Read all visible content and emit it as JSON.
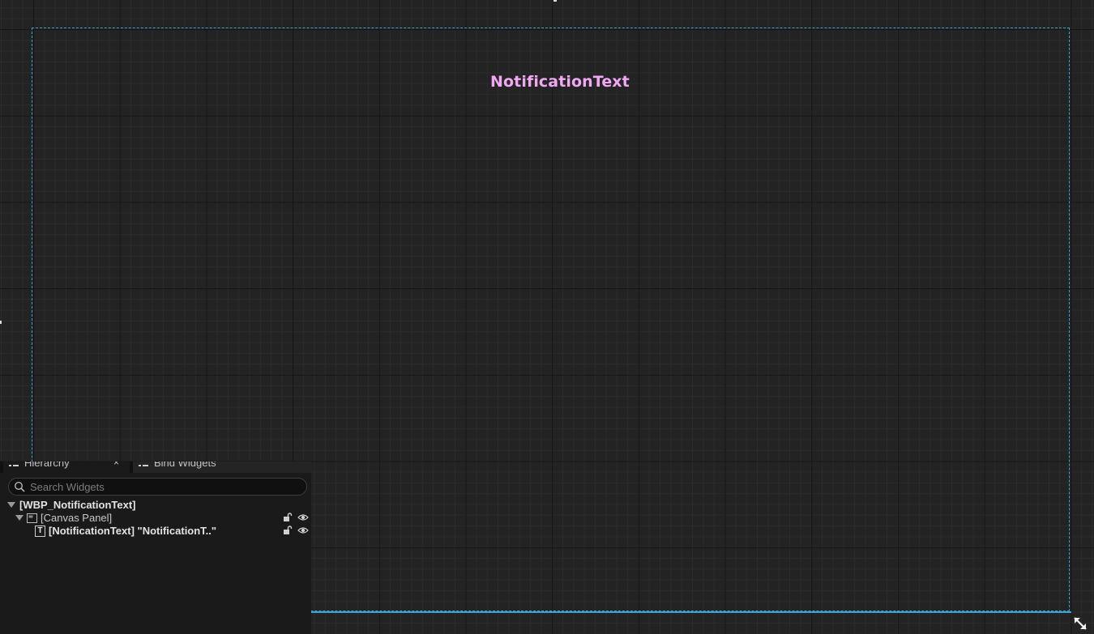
{
  "designer": {
    "widget_text": "NotificationText"
  },
  "hierarchy": {
    "tabs": [
      {
        "label": "Hierarchy",
        "icon": "hierarchy-icon",
        "closable": true,
        "close_glyph": "×"
      },
      {
        "label": "Bind Widgets",
        "icon": "bind-widgets-icon"
      }
    ],
    "search": {
      "placeholder": "Search Widgets",
      "value": ""
    },
    "tree": [
      {
        "label": "[WBP_NotificationText]",
        "expanded": true
      },
      {
        "label": "[Canvas Panel]",
        "icon": "canvas-panel-icon",
        "expanded": true,
        "locked": false,
        "visible": true
      },
      {
        "label": "[NotificationText] \"NotificationT..\"",
        "icon": "text-widget-icon",
        "icon_glyph": "T",
        "locked": false,
        "visible": true
      }
    ]
  },
  "colors": {
    "canvas_border": "#3aa2d0",
    "widget_text": "#f0a8f2",
    "background": "#232323"
  }
}
